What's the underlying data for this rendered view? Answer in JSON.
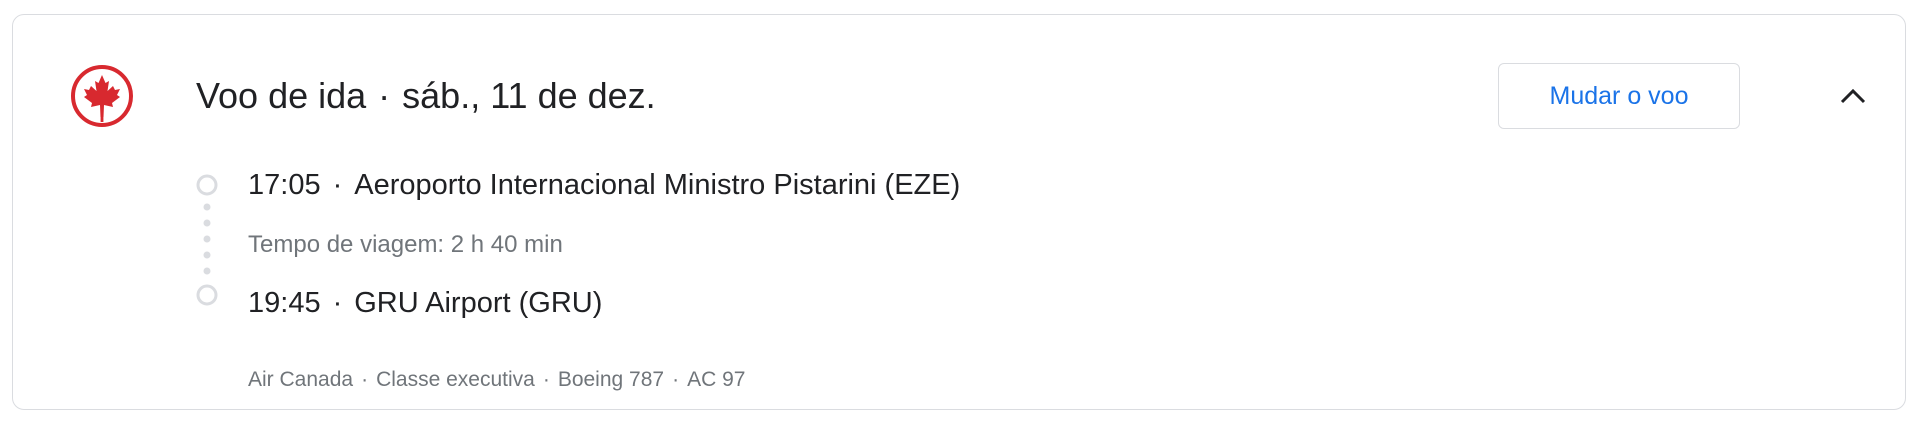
{
  "flight": {
    "label": "Voo de ida",
    "date": "sáb., 11 de dez.",
    "change_button": "Mudar o voo",
    "airline_logo": "maple-leaf-icon",
    "departure": {
      "time": "17:05",
      "airport": "Aeroporto Internacional Ministro Pistarini (EZE)"
    },
    "duration": "Tempo de viagem: 2 h 40 min",
    "arrival": {
      "time": "19:45",
      "airport": "GRU Airport (GRU)"
    },
    "details": {
      "airline": "Air Canada",
      "cabin": "Classe executiva",
      "aircraft": "Boeing 787",
      "flight_number": "AC 97"
    }
  },
  "separator": "·",
  "colors": {
    "brand_red": "#d8292f",
    "link_blue": "#1a73e8",
    "secondary_text": "#70757a",
    "border": "#dadce0"
  }
}
